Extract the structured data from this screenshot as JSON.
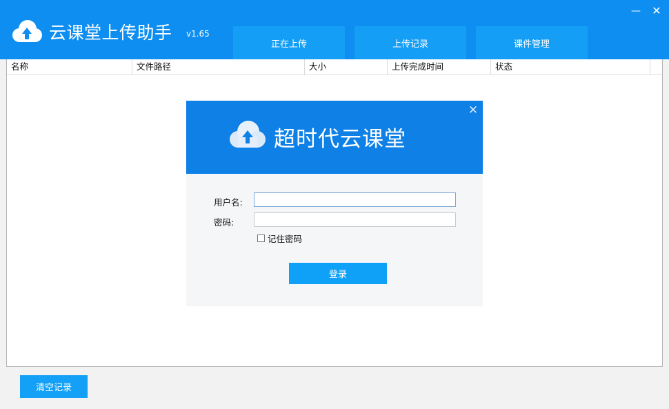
{
  "app": {
    "title": "云课堂上传助手",
    "version": "v1.65",
    "accent_color": "#0e8ef0",
    "icons": {
      "logo": "cloud-upload-icon",
      "minimize": "minimize-icon",
      "close": "close-icon"
    }
  },
  "window": {
    "minimize_glyph": "—",
    "close_glyph": "✕"
  },
  "tabs": [
    {
      "label": "正在上传"
    },
    {
      "label": "上传记录"
    },
    {
      "label": "课件管理"
    }
  ],
  "table": {
    "columns": [
      "名称",
      "文件路径",
      "大小",
      "上传完成时间",
      "状态"
    ],
    "rows": []
  },
  "login_dialog": {
    "title": "超时代云课堂",
    "close_glyph": "✕",
    "header_color": "#0e80e6",
    "username_label": "用户名:",
    "username_value": "",
    "password_label": "密码:",
    "password_value": "",
    "remember_label": "记住密码",
    "remember_checked": false,
    "login_button": "登录"
  },
  "footer": {
    "clear_button": "清空记录"
  }
}
